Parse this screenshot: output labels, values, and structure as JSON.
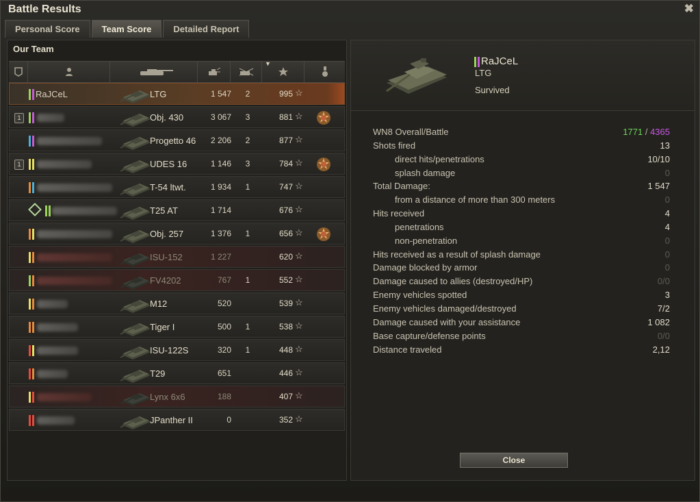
{
  "window": {
    "title": "Battle Results",
    "close_glyph": "✖"
  },
  "tabs": [
    {
      "label": "Personal Score",
      "active": false
    },
    {
      "label": "Team Score",
      "active": true
    },
    {
      "label": "Detailed Report",
      "active": false
    }
  ],
  "team": {
    "title": "Our Team",
    "columns": [
      "squad-icon",
      "player-icon",
      "vehicle-icon",
      "damage-icon",
      "kills-icon",
      "xp-star-icon",
      "medal-icon"
    ],
    "rows": [
      {
        "self": true,
        "dead": false,
        "badge": "",
        "name": "RaJCeL",
        "marks": [
          "#9ad45a",
          "#c45ad8"
        ],
        "tank": "LTG",
        "damage": "1 547",
        "kills": "2",
        "xp": "995",
        "medal": false,
        "blur_w": 0
      },
      {
        "self": false,
        "dead": false,
        "badge": "1",
        "name": "",
        "marks": [
          "#9ad45a",
          "#c45ad8"
        ],
        "tank": "Obj. 430",
        "damage": "3 067",
        "kills": "3",
        "xp": "881",
        "medal": true,
        "blur_w": 40
      },
      {
        "self": false,
        "dead": false,
        "badge": "",
        "name": "",
        "marks": [
          "#4ab0d8",
          "#c45ad8"
        ],
        "tank": "Progetto 46",
        "damage": "2 206",
        "kills": "2",
        "xp": "877",
        "medal": false,
        "blur_w": 95
      },
      {
        "self": false,
        "dead": false,
        "badge": "1",
        "name": "",
        "marks": [
          "#e8e060",
          "#e8e060"
        ],
        "tank": "UDES 16",
        "damage": "1 146",
        "kills": "3",
        "xp": "784",
        "medal": true,
        "blur_w": 80
      },
      {
        "self": false,
        "dead": false,
        "badge": "",
        "name": "",
        "marks": [
          "#e88a3a",
          "#4ab0d8"
        ],
        "tank": "T-54 ltwt.",
        "damage": "1 934",
        "kills": "1",
        "xp": "747",
        "medal": false,
        "blur_w": 110
      },
      {
        "self": false,
        "dead": false,
        "badge": "",
        "name": "",
        "marks": [
          "#9ad45a",
          "#9ad45a"
        ],
        "tank": "T25 AT",
        "damage": "1 714",
        "kills": "",
        "xp": "676",
        "medal": false,
        "blur_w": 95,
        "platoon_icon": true
      },
      {
        "self": false,
        "dead": false,
        "badge": "",
        "name": "",
        "marks": [
          "#e88a3a",
          "#e8e060"
        ],
        "tank": "Obj. 257",
        "damage": "1 376",
        "kills": "1",
        "xp": "656",
        "medal": true,
        "blur_w": 110
      },
      {
        "self": false,
        "dead": true,
        "badge": "",
        "name": "",
        "marks": [
          "#e8e060",
          "#e88a3a"
        ],
        "tank": "ISU-152",
        "damage": "1 227",
        "kills": "",
        "xp": "620",
        "medal": false,
        "blur_w": 110
      },
      {
        "self": false,
        "dead": true,
        "badge": "",
        "name": "",
        "marks": [
          "#9ad45a",
          "#e88a3a"
        ],
        "tank": "FV4202",
        "damage": "767",
        "kills": "1",
        "xp": "552",
        "medal": false,
        "blur_w": 110
      },
      {
        "self": false,
        "dead": false,
        "badge": "",
        "name": "",
        "marks": [
          "#e8e060",
          "#e88a3a"
        ],
        "tank": "M12",
        "damage": "520",
        "kills": "",
        "xp": "539",
        "medal": false,
        "blur_w": 45
      },
      {
        "self": false,
        "dead": false,
        "badge": "",
        "name": "",
        "marks": [
          "#e88a3a",
          "#e88a3a"
        ],
        "tank": "Tiger I",
        "damage": "500",
        "kills": "1",
        "xp": "538",
        "medal": false,
        "blur_w": 60
      },
      {
        "self": false,
        "dead": false,
        "badge": "",
        "name": "",
        "marks": [
          "#e84a3a",
          "#e8e060"
        ],
        "tank": "ISU-122S",
        "damage": "320",
        "kills": "1",
        "xp": "448",
        "medal": false,
        "blur_w": 60
      },
      {
        "self": false,
        "dead": false,
        "badge": "",
        "name": "",
        "marks": [
          "#e84a3a",
          "#e88a3a"
        ],
        "tank": "T29",
        "damage": "651",
        "kills": "",
        "xp": "446",
        "medal": false,
        "blur_w": 45
      },
      {
        "self": false,
        "dead": true,
        "badge": "",
        "name": "",
        "marks": [
          "#e8e060",
          "#e84a3a"
        ],
        "tank": "Lynx 6x6",
        "damage": "188",
        "kills": "",
        "xp": "407",
        "medal": false,
        "blur_w": 80
      },
      {
        "self": false,
        "dead": false,
        "badge": "",
        "name": "",
        "marks": [
          "#e84a3a",
          "#e84a3a"
        ],
        "tank": "JPanther II",
        "damage": "0",
        "kills": "",
        "xp": "352",
        "medal": false,
        "blur_w": 55
      }
    ]
  },
  "detail": {
    "player_name": "RaJCeL",
    "marks": [
      "#9ad45a",
      "#c45ad8"
    ],
    "vehicle": "LTG",
    "status": "Survived",
    "wn8_overall": "1771",
    "wn8_sep": " / ",
    "wn8_battle": "4365",
    "wn8_overall_color": "#6cd657",
    "wn8_battle_color": "#c757e0",
    "stats": [
      {
        "label": "WN8 Overall/Battle",
        "value": "",
        "sub": false,
        "dim": false,
        "wn8": true
      },
      {
        "label": "Shots fired",
        "value": "13",
        "sub": false,
        "dim": false
      },
      {
        "label": "direct hits/penetrations",
        "value": "10/10",
        "sub": true,
        "dim": false
      },
      {
        "label": "splash damage",
        "value": "0",
        "sub": true,
        "dim": true
      },
      {
        "label": "Total Damage:",
        "value": "1 547",
        "sub": false,
        "dim": false
      },
      {
        "label": "from a distance of more than 300 meters",
        "value": "0",
        "sub": true,
        "dim": true
      },
      {
        "label": "Hits received",
        "value": "4",
        "sub": false,
        "dim": false
      },
      {
        "label": "penetrations",
        "value": "4",
        "sub": true,
        "dim": false
      },
      {
        "label": "non-penetration",
        "value": "0",
        "sub": true,
        "dim": true
      },
      {
        "label": "Hits received as a result of splash damage",
        "value": "0",
        "sub": false,
        "dim": true
      },
      {
        "label": "Damage blocked by armor",
        "value": "0",
        "sub": false,
        "dim": true
      },
      {
        "label": "Damage caused to allies (destroyed/HP)",
        "value": "0/0",
        "sub": false,
        "dim": true
      },
      {
        "label": "Enemy vehicles spotted",
        "value": "3",
        "sub": false,
        "dim": false
      },
      {
        "label": "Enemy vehicles damaged/destroyed",
        "value": "7/2",
        "sub": false,
        "dim": false
      },
      {
        "label": "Damage caused with your assistance",
        "value": "1 082",
        "sub": false,
        "dim": false
      },
      {
        "label": "Base capture/defense points",
        "value": "0/0",
        "sub": false,
        "dim": true
      },
      {
        "label": "Distance traveled",
        "value": "2,12",
        "sub": false,
        "dim": false
      }
    ],
    "close_label": "Close"
  }
}
